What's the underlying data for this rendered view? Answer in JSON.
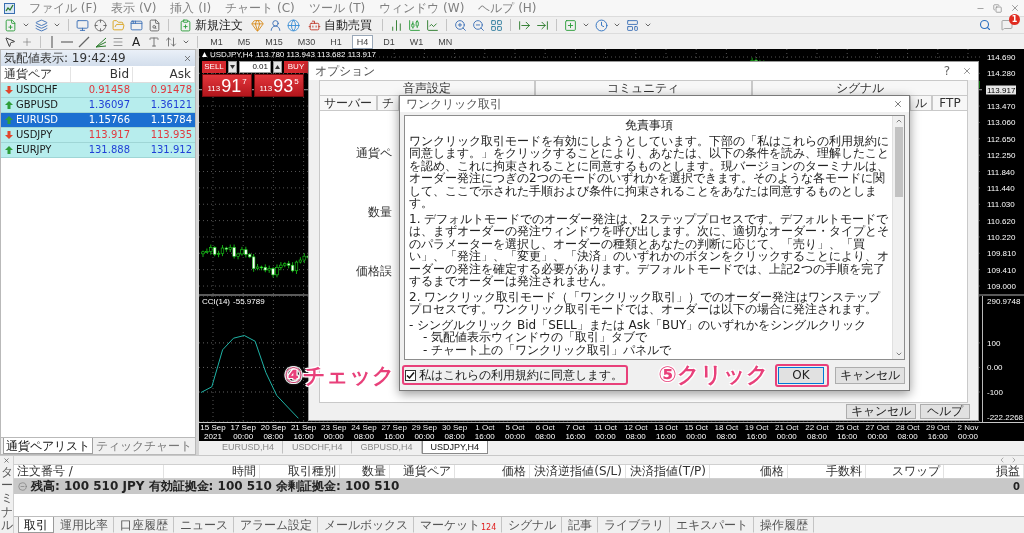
{
  "menu_bar": {
    "items": [
      "ファイル (F)",
      "表示 (V)",
      "挿入 (I)",
      "チャート (C)",
      "ツール (T)",
      "ウィンドウ (W)",
      "ヘルプ (H)"
    ]
  },
  "toolbar": {
    "new_order": "新規注文",
    "auto_trading": "自動売買",
    "notification_count": "1"
  },
  "drawing_toolbar": {
    "text_tool": "A",
    "timeframes": [
      {
        "label": "M1",
        "selected": false
      },
      {
        "label": "M5",
        "selected": false
      },
      {
        "label": "M15",
        "selected": false
      },
      {
        "label": "M30",
        "selected": false
      },
      {
        "label": "H1",
        "selected": false
      },
      {
        "label": "H4",
        "selected": true
      },
      {
        "label": "D1",
        "selected": false
      },
      {
        "label": "W1",
        "selected": false
      },
      {
        "label": "MN",
        "selected": false
      }
    ]
  },
  "market_watch": {
    "title": "気配値表示: 19:42:49",
    "columns": [
      "通貨ペア",
      "Bid",
      "Ask"
    ],
    "rows": [
      {
        "symbol": "USDCHF",
        "bid": "0.91458",
        "ask": "0.91478",
        "rising": false,
        "selected": false
      },
      {
        "symbol": "GBPUSD",
        "bid": "1.36097",
        "ask": "1.36121",
        "rising": true,
        "selected": false
      },
      {
        "symbol": "EURUSD",
        "bid": "1.15766",
        "ask": "1.15784",
        "rising": true,
        "selected": true
      },
      {
        "symbol": "USDJPY",
        "bid": "113.917",
        "ask": "113.935",
        "rising": false,
        "selected": false
      },
      {
        "symbol": "EURJPY",
        "bid": "131.888",
        "ask": "131.912",
        "rising": true,
        "selected": false
      }
    ],
    "tabs": [
      {
        "label": "通貨ペアリスト",
        "selected": true
      },
      {
        "label": "ティックチャート",
        "selected": false
      }
    ]
  },
  "chart": {
    "symbol": "USDJPY,H4",
    "ohlc": "113.780 113.943 113.682 113.917",
    "one_click": {
      "sell": "SELL",
      "buy": "BUY",
      "lot": "0.01",
      "sell_price": {
        "big_figure": "113",
        "pips": "91",
        "fraction": "7"
      },
      "buy_price": {
        "big_figure": "113",
        "pips": "93",
        "fraction": "5"
      }
    },
    "price_axis": [
      {
        "label": "114.690",
        "highlighted": false
      },
      {
        "label": "114.280",
        "highlighted": false
      },
      {
        "label": "113.917",
        "highlighted": true
      },
      {
        "label": "113.470",
        "highlighted": false
      },
      {
        "label": "113.060",
        "highlighted": false
      },
      {
        "label": "112.650",
        "highlighted": false
      },
      {
        "label": "112.250",
        "highlighted": false
      },
      {
        "label": "111.840",
        "highlighted": false
      },
      {
        "label": "111.440",
        "highlighted": false
      },
      {
        "label": "111.030",
        "highlighted": false
      },
      {
        "label": "110.620",
        "highlighted": false
      },
      {
        "label": "110.220",
        "highlighted": false
      },
      {
        "label": "109.810",
        "highlighted": false
      },
      {
        "label": "109.410",
        "highlighted": false
      },
      {
        "label": "109.000",
        "highlighted": false
      }
    ],
    "indicator": {
      "reading": "-55.9789",
      "chart_data": {
        "type": "line",
        "ylim": [
          -222.2268,
          290.9748
        ],
        "yticks": [
          290.9748,
          100,
          {
            "value": 0,
            "label": "0.00"
          },
          -100,
          -222.2268
        ],
        "grid": true,
        "series": [
          {
            "name": "CCI(14)",
            "color": "#1fb3a6",
            "values": [
              -102,
              -79,
              72,
              119,
              130,
              107,
              -21,
              -114,
              -161,
              -207,
              null,
              null,
              null,
              null,
              null,
              null,
              null,
              null,
              null,
              null,
              null,
              null,
              null,
              null,
              null,
              null,
              null,
              null,
              null,
              null,
              null,
              null,
              null,
              null,
              null,
              null,
              null,
              null,
              null,
              null,
              null,
              null,
              null,
              null,
              null,
              null,
              null,
              null,
              null,
              null,
              null,
              null,
              null,
              null,
              null,
              null,
              null,
              null,
              null,
              null,
              null,
              null,
              null,
              null,
              null,
              null,
              null,
              null,
              null,
              null,
              null,
              null,
              null
            ]
          }
        ]
      }
    },
    "time_axis": [
      "15 Sep 2021",
      "17 Sep 00:00",
      "20 Sep 08:00",
      "21 Sep 16:00",
      "23 Sep 00:00",
      "24 Sep 08:00",
      "27 Sep 16:00",
      "29 Sep 00:00",
      "30 Sep 08:00",
      "1 Oct 16:00",
      "5 Oct 00:00",
      "6 Oct 08:00",
      "7 Oct 16:00",
      "11 Oct 00:00",
      "12 Oct 08:00",
      "13 Oct 16:00",
      "15 Oct 00:00",
      "18 Oct 08:00",
      "19 Oct 16:00",
      "21 Oct 00:00",
      "22 Oct 08:00",
      "25 Oct 16:00",
      "27 Oct 00:00",
      "28 Oct 08:00",
      "29 Oct 16:00",
      "2 Nov 00:00"
    ]
  },
  "chart_tabs": [
    {
      "label": "EURUSD,H4",
      "selected": false
    },
    {
      "label": "USDCHF,H4",
      "selected": false
    },
    {
      "label": "GBPUSD,H4",
      "selected": false
    },
    {
      "label": "USDJPY,H4",
      "selected": true
    }
  ],
  "options_dialog": {
    "title": "オプション",
    "help": "?",
    "top_tabs": [
      "音声設定",
      "コミュニティ",
      "シグナル"
    ],
    "bottom_tabs": [
      "サーバー",
      "チ",
      "ル",
      "FTP"
    ],
    "labels": [
      "通貨ペ",
      "数量",
      "価格誤"
    ],
    "buttons": [
      "キャンセル",
      "ヘルプ"
    ]
  },
  "one_click_dialog": {
    "title": "ワンクリック取引",
    "terms": {
      "title": "免責事項",
      "paragraphs": [
        "ワンクリック取引モードを有効にしようとしています。下部の「私はこれらの利用規約に同意します。」をクリックすることにより、あなたは、以下の条件を読み、理解したことを認め、これに拘束されることに同意するものとします。現バージョンのターミナルは、オーダー発注につぎの2つのモードのいずれかを選択できます。そのような各モードに関して、ここで示された手順および条件に拘束されることをあなたは同意するものとします。",
        "1. デフォルトモードでのオーダー発注は、2ステッププロセスです。デフォルトモードでは、まずオーダーの発注ウィンドウを呼び出します。次に、適切なオーダー・タイプとそのパラメーターを選択し、オーダーの種類とあなたの判断に応じて、「売り」、「買い」、「発注」、「変更」、「決済」のいずれかのボタンをクリックすることにより、オーダーの発注を確定する必要があります。デフォルトモードでは、上記2つの手順を完了するまでオーダーは発注されません。",
        "2. ワンクリック取引モード（「ワンクリック取引」）でのオーダー発注はワンステッププロセスです。ワンクリック取引モードでは、オーダーは以下の場合に発注されます。"
      ],
      "list": [
        {
          "text": "- シングルクリック Bid「SELL」または Ask「BUY」のいずれかをシングルクリック",
          "children": [
            {
              "text": "- 気配値表示ウィンドウの「取引」タブで"
            },
            {
              "text": "- チャート上の「ワンクリック取引」パネルで"
            }
          ]
        }
      ]
    },
    "agree": {
      "label": "私はこれらの利用規約に同意します。",
      "checked": true,
      "highlighted": true
    },
    "ok": {
      "label": "OK",
      "highlighted": true
    },
    "cancel": "キャンセル"
  },
  "annotations": [
    {
      "label": "④チェック"
    },
    {
      "label": "⑤クリック"
    }
  ],
  "terminal": {
    "title": "ターミナル",
    "columns": [
      "注文番号 /",
      "時間",
      "取引種別",
      "数量",
      "通貨ペア",
      "価格",
      "決済逆指値(S/L)",
      "決済指値(T/P)",
      "価格",
      "手数料",
      "スワップ",
      "損益"
    ],
    "balance": "残高: 100 510 JPY 有効証拠金: 100 510 余剰証拠金: 100 510",
    "profit": "0",
    "tabs": [
      {
        "label": "取引",
        "selected": true
      },
      {
        "label": "運用比率",
        "selected": false
      },
      {
        "label": "口座履歴",
        "selected": false
      },
      {
        "label": "ニュース",
        "selected": false
      },
      {
        "label": "アラーム設定",
        "selected": false
      },
      {
        "label": "メールボックス",
        "selected": false
      },
      {
        "label": "マーケット",
        "badge": "124",
        "selected": false
      },
      {
        "label": "シグナル",
        "selected": false
      },
      {
        "label": "記事",
        "selected": false
      },
      {
        "label": "ライブラリ",
        "selected": false
      },
      {
        "label": "エキスパート",
        "selected": false
      },
      {
        "label": "操作履歴",
        "selected": false
      }
    ]
  }
}
